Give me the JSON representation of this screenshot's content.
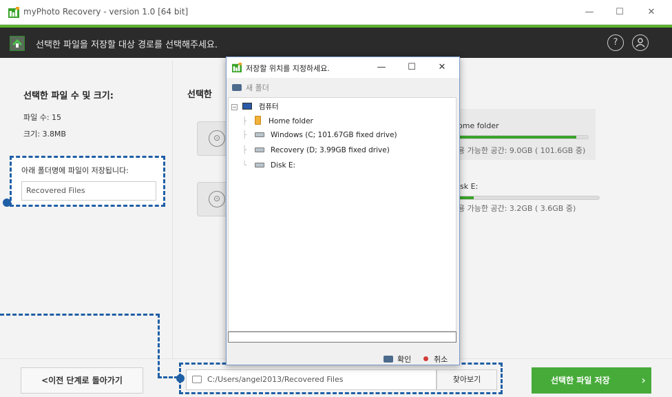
{
  "window": {
    "title": "myPhoto Recovery - version 1.0 [64 bit]",
    "controls": {
      "minimize": "—",
      "maximize": "☐",
      "close": "✕"
    }
  },
  "header": {
    "instruction": "선택한 파일을 저장할 대상 경로를 선택해주세요.",
    "help_icon": "?",
    "account_icon": "user-icon"
  },
  "left_panel": {
    "title": "선택한 파일 수 및 크기:",
    "file_count": "파일 수: 15",
    "file_size": "크기: 3.8MB",
    "folder_label": "아래 폴더명에 파일이 저장됩니다:",
    "folder_name_value": "Recovered Files"
  },
  "right_panel": {
    "title": "선택한",
    "cards": [
      {
        "name": "ome folder",
        "space": "용 가능한 공간: 9.0GB ( 101.6GB 중)",
        "fill": 0.91
      },
      {
        "name": "isk E:",
        "space": "용 가능한 공간: 3.2GB ( 3.6GB 중)",
        "fill": 0.11
      }
    ]
  },
  "bottom": {
    "back_label": "<이전 단계로 돌아가기",
    "path_value": "C:/Users/angel2013/Recovered Files",
    "browse_label": "찾아보기",
    "save_label": "선택한 파일 저장",
    "save_arrow": "›"
  },
  "dialog": {
    "title": "저장할 위치를 지정하세요.",
    "new_folder": "새 폴더",
    "tree": {
      "root": "컴퓨터",
      "items": [
        {
          "label": "Home folder",
          "icon": "folder-icon"
        },
        {
          "label": "Windows (C; 101.67GB fixed drive)",
          "icon": "drive-icon"
        },
        {
          "label": "Recovery (D; 3.99GB fixed drive)",
          "icon": "drive-icon"
        },
        {
          "label": "Disk E:",
          "icon": "drive-icon"
        }
      ]
    },
    "input_value": "",
    "ok_label": "확인",
    "cancel_label": "취소"
  },
  "colors": {
    "accent_green": "#47ab3a",
    "highlight_blue": "#1f5fa5",
    "header_dark": "#2b2b2b"
  }
}
